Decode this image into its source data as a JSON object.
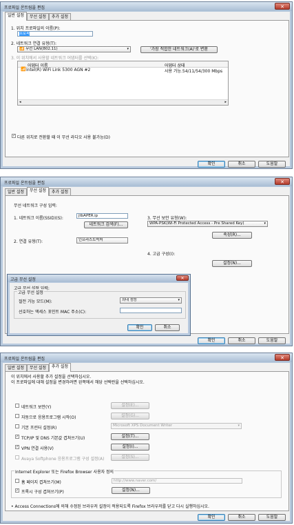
{
  "w1": {
    "title": "프로파일 온트림을 편집",
    "tabs": [
      "일반 설정",
      "무선 설정",
      "추가 설정"
    ],
    "profile_name_label": "1. 위치 프로파일의 이름(P):",
    "profile_name_value": "프로파",
    "conn_type_label": "2. 네트워크 연결 유형(T):",
    "conn_type_value": "무선 LAN(802.11)",
    "best_network_button": "'가장 적합한 네트워크(A)'로 변환",
    "adapter_label": "3. 이 위치에서 사용할 네트워크 어댑터를 선택(K):",
    "adapter_col_name": "어댑터 이름",
    "adapter_col_status": "어댑터 상태",
    "adapter_name": "Intel(R) WiFi Link 5300 AGN #2",
    "adapter_status": "사용 가능.54/11/54/300 Mbps",
    "radio_checkbox_label": "다른 위치로 전환할 때 이 무선 라디오 사용 불가능(D)",
    "ok": "확인",
    "cancel": "취소",
    "help": "도움말"
  },
  "w2": {
    "title": "프로파일 온트림을 편집",
    "tabs": [
      "일반 설정",
      "무선 설정",
      "추가 설정"
    ],
    "heading": "무선 네트워크 구성 입력:",
    "ssid_label": "1. 네트워크 이름(SSID)(S):",
    "ssid_value": "jtbAPER.ip",
    "network_search_button": "네트워크 검색(F)...",
    "conn_type_label": "2. 연결 유형(T):",
    "conn_type_value": "인프라스트럭처",
    "security_label": "3. 무선 보안 유형(W):",
    "security_value": "WPA-PSK(Wi-Fi Protected Access - Pre Shared Key)",
    "properties_button": "속성(R)...",
    "advanced_label": "4. 고급 구성(I):",
    "settings_button": "설정(N)...",
    "ok": "확인",
    "cancel": "취소",
    "help": "도움말",
    "dialog": {
      "title": "고급 무선 설정",
      "heading": "고급 무선 설정 입력:",
      "group_title": "고급 무선 설정",
      "power_label": "절전 가능 모드(M):",
      "power_value": "최대 성능",
      "mac_label": "선호하는 액세스 포인트 MAC 주소(C):",
      "ok": "확인",
      "cancel": "취소"
    }
  },
  "w3": {
    "title": "프로파일 온트림을 편집",
    "tabs": [
      "일반 설정",
      "무선 설정",
      "추가 설정"
    ],
    "desc1": "이 위치에서 사용할 추가 설정을 선택하십시오.",
    "desc2": "이 프로파일에 대해 설정을 변경하려면 왼쪽에서 해당 선택란을 선택하십시오.",
    "rows": [
      {
        "label": "네트워크 보안(Y)",
        "checked": false,
        "button": "설정(E)...",
        "enabled": false
      },
      {
        "label": "자동으로 응용프로그램 시작(O)",
        "checked": false,
        "button": "설정(G)...",
        "enabled": false
      },
      {
        "label": "기본 프린터 설정(R)",
        "checked": false,
        "select": "Microsoft XPS Document Writer",
        "enabled": false
      },
      {
        "label": "TCP/IP 및 DNS 기본값 겹쳐쓰기(U)",
        "checked": true,
        "button": "설정(T)...",
        "enabled": true
      },
      {
        "label": "VPN 연결 사용(V)",
        "checked": true,
        "button": "설정(I)...",
        "enabled": true
      },
      {
        "label": "Avaya Softphone 응용프로그램 구성 설정(A)",
        "checked": false,
        "button": "설정(S)...",
        "enabled": false
      }
    ],
    "ie_group_title": "Internet Explorer 또는 Firefox Browser 사용자 정의",
    "homepage_label": "홈 페이지 겹쳐쓰기(M)",
    "homepage_value": "http://www.naver.com/",
    "proxy_label": "프록시 구성 겹쳐쓰기(P)",
    "proxy_button": "설정(N)...",
    "note": "• Access Connections에 의해 수정된 브라우저 설정이 적용되도록 Firefox 브라우저를 닫고 다시 실행하십시오.",
    "ok": "확인",
    "cancel": "취소",
    "help": "도움말"
  }
}
